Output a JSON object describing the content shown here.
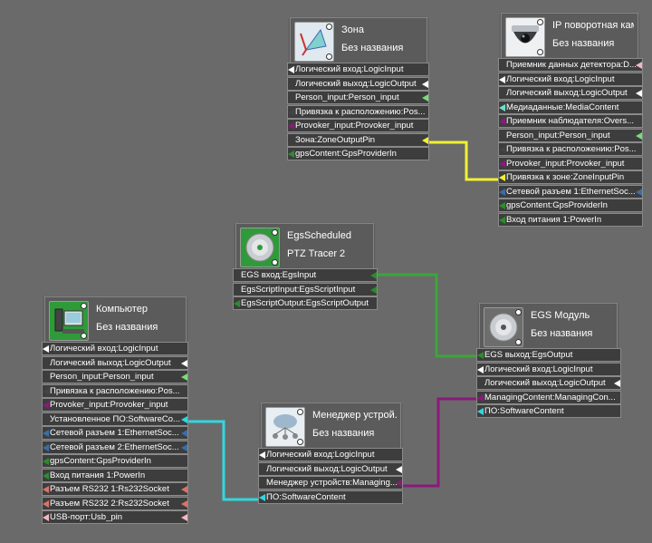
{
  "nodes": {
    "zona": {
      "title": "Зона",
      "subtitle": "Без названия",
      "icon": "zone-icon",
      "ports": [
        {
          "label": "Логический вход:LogicInput",
          "color": "#ffffff",
          "side": "l"
        },
        {
          "label": "Логический выход:LogicOutput",
          "color": "#ffffff",
          "side": "r"
        },
        {
          "label": "Person_input:Person_input",
          "color": "#77dd77",
          "side": "r"
        },
        {
          "label": "Привязка к расположению:Pos...",
          "color": "#444444",
          "side": "l"
        },
        {
          "label": "Provoker_input:Provoker_input",
          "color": "#8a1a7a",
          "side": "l"
        },
        {
          "label": "Зона:ZoneOutputPin",
          "color": "#f1f132",
          "side": "r"
        },
        {
          "label": "gpsContent:GpsProviderIn",
          "color": "#2e8b2e",
          "side": "l"
        }
      ]
    },
    "camera": {
      "title": "IP поворотная кам...",
      "subtitle": "Без названия",
      "icon": "camera-icon",
      "ports": [
        {
          "label": "Приемник данных детектора:D...",
          "color": "#f4b6c0",
          "side": "r"
        },
        {
          "label": "Логический вход:LogicInput",
          "color": "#ffffff",
          "side": "l"
        },
        {
          "label": "Логический выход:LogicOutput",
          "color": "#ffffff",
          "side": "r"
        },
        {
          "label": "Медиаданные:MediaContent",
          "color": "#6fe0c8",
          "side": "l"
        },
        {
          "label": "Приемник наблюдателя:Overs...",
          "color": "#8a1a7a",
          "side": "l"
        },
        {
          "label": "Person_input:Person_input",
          "color": "#77dd77",
          "side": "r"
        },
        {
          "label": "Привязка к расположению:Pos...",
          "color": "#444444",
          "side": "l"
        },
        {
          "label": "Provoker_input:Provoker_input",
          "color": "#8a1a7a",
          "side": "l"
        },
        {
          "label": "Привязка к зоне:ZoneInputPin",
          "color": "#f1f132",
          "side": "l"
        },
        {
          "label": "Сетевой разъем 1:EthernetSoc...",
          "color": "#3a6ea5",
          "side": "lr"
        },
        {
          "label": "gpsContent:GpsProviderIn",
          "color": "#2e8b2e",
          "side": "l"
        },
        {
          "label": "Вход питания 1:PowerIn",
          "color": "#2e8b2e",
          "side": "l"
        }
      ]
    },
    "egs_scheduled": {
      "title": "EgsScheduled",
      "subtitle": "PTZ Tracer 2",
      "icon": "disc-icon",
      "ports": [
        {
          "label": "EGS вход:EgsInput",
          "color": "#2e8b2e",
          "side": "r"
        },
        {
          "label": "EgsScriptInput:EgsScriptInput",
          "color": "#2e8b2e",
          "side": "r"
        },
        {
          "label": "EgsScriptOutput:EgsScriptOutput",
          "color": "#2e8b2e",
          "side": "l"
        }
      ]
    },
    "computer": {
      "title": "Компьютер",
      "subtitle": "Без названия",
      "icon": "computer-icon",
      "ports": [
        {
          "label": "Логический вход:LogicInput",
          "color": "#ffffff",
          "side": "l"
        },
        {
          "label": "Логический выход:LogicOutput",
          "color": "#ffffff",
          "side": "r"
        },
        {
          "label": "Person_input:Person_input",
          "color": "#77dd77",
          "side": "r"
        },
        {
          "label": "Привязка к расположению:Pos...",
          "color": "#444444",
          "side": "l"
        },
        {
          "label": "Provoker_input:Provoker_input",
          "color": "#8a1a7a",
          "side": "l"
        },
        {
          "label": "Установленное ПО:SoftwareCo...",
          "color": "#33d6e0",
          "side": "r"
        },
        {
          "label": "Сетевой разъем 1:EthernetSoc...",
          "color": "#3a6ea5",
          "side": "lr"
        },
        {
          "label": "Сетевой разъем 2:EthernetSoc...",
          "color": "#3a6ea5",
          "side": "lr"
        },
        {
          "label": "gpsContent:GpsProviderIn",
          "color": "#2e8b2e",
          "side": "l"
        },
        {
          "label": "Вход питания 1:PowerIn",
          "color": "#2e8b2e",
          "side": "l"
        },
        {
          "label": "Разъем RS232 1:Rs232Socket",
          "color": "#d9736a",
          "side": "lr"
        },
        {
          "label": "Разъем RS232 2:Rs232Socket",
          "color": "#d9736a",
          "side": "lr"
        },
        {
          "label": "USB-порт:Usb_pin",
          "color": "#f4b6c0",
          "side": "lr"
        }
      ]
    },
    "egs_module": {
      "title": "EGS Модуль",
      "subtitle": "Без названия",
      "icon": "disc-icon",
      "ports": [
        {
          "label": "EGS выход:EgsOutput",
          "color": "#2e8b2e",
          "side": "l"
        },
        {
          "label": "Логический вход:LogicInput",
          "color": "#ffffff",
          "side": "l"
        },
        {
          "label": "Логический выход:LogicOutput",
          "color": "#ffffff",
          "side": "r"
        },
        {
          "label": "ManagingContent:ManagingCon...",
          "color": "#8a1a7a",
          "side": "l"
        },
        {
          "label": "ПО:SoftwareContent",
          "color": "#33d6e0",
          "side": "l"
        }
      ]
    },
    "device_manager": {
      "title": "Менеджер устрой...",
      "subtitle": "Без названия",
      "icon": "cloud-icon",
      "ports": [
        {
          "label": "Логический вход:LogicInput",
          "color": "#ffffff",
          "side": "l"
        },
        {
          "label": "Логический выход:LogicOutput",
          "color": "#ffffff",
          "side": "r"
        },
        {
          "label": "Менеджер устройств:Managing...",
          "color": "#8a1a7a",
          "side": "r"
        },
        {
          "label": "ПО:SoftwareContent",
          "color": "#33d6e0",
          "side": "l"
        }
      ]
    }
  },
  "connections": [
    {
      "color": "#f1f132"
    },
    {
      "color": "#3aa63a"
    },
    {
      "color": "#8a1a7a"
    },
    {
      "color": "#33d6e0"
    }
  ]
}
